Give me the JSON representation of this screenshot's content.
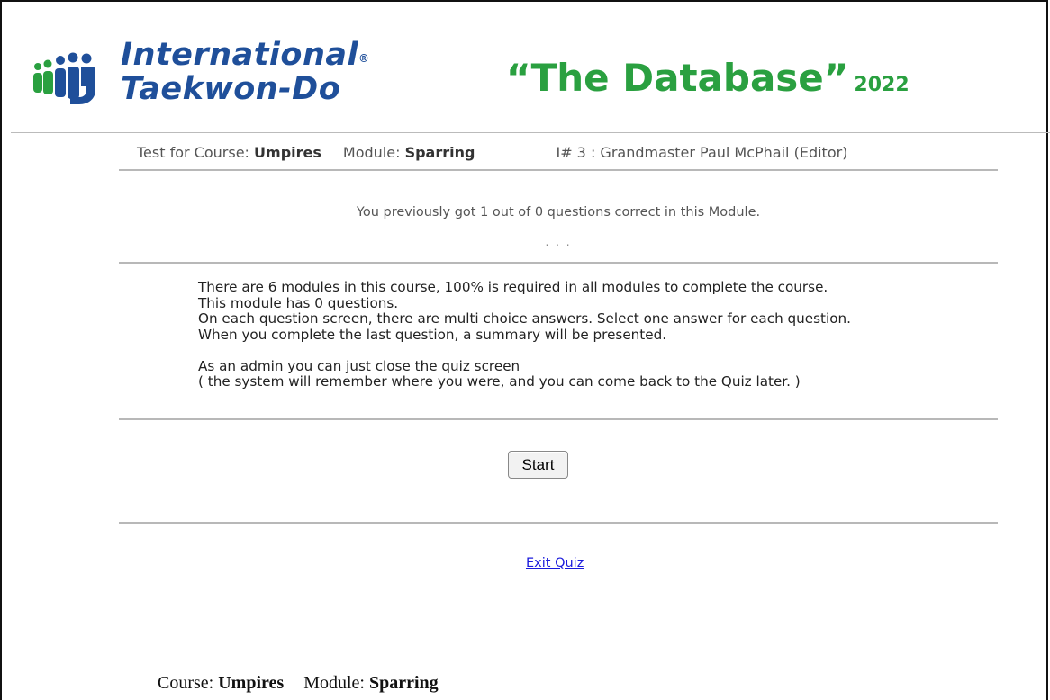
{
  "header": {
    "logo_line1": "International",
    "logo_registered": "®",
    "logo_line2": "Taekwon-Do",
    "db_title": "“The Database”",
    "db_year": "2022",
    "colors": {
      "logo_blue": "#1f4f9a",
      "title_green": "#2aa040"
    }
  },
  "info_bar": {
    "course_label": "Test for Course:",
    "course_value": "Umpires",
    "module_label": "Module:",
    "module_value": "Sparring",
    "instructor": "I# 3 : Grandmaster Paul McPhail (Editor)"
  },
  "previous_result": "You previously got 1 out of 0 questions correct in this Module.",
  "dots": ". . .",
  "instructions": {
    "line1": "There are 6 modules in this course, 100% is required in all modules to complete the course.",
    "line2": "This module has 0 questions.",
    "line3": "On each question screen, there are multi choice answers. Select one answer for each question.",
    "line4": "When you complete the last question, a summary will be presented.",
    "line5": "As an admin you can just close the quiz screen",
    "line6": "( the system will remember where you were, and you can come back to the Quiz later. )"
  },
  "start_button": "Start",
  "exit_link": "Exit Quiz",
  "footer": {
    "course_label": "Course:",
    "course_value": "Umpires",
    "module_label": "Module:",
    "module_value": "Sparring"
  }
}
